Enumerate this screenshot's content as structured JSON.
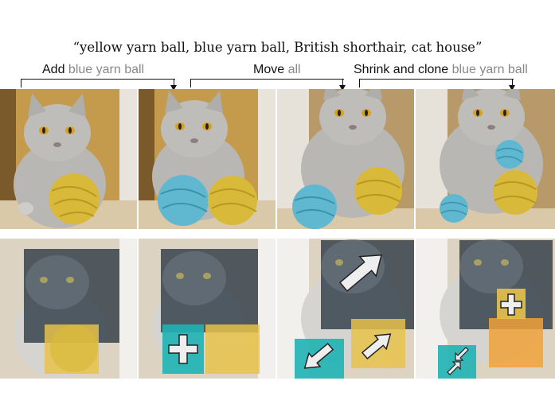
{
  "caption": "“yellow yarn ball, blue yarn ball, British shorthair, cat house”",
  "operations": [
    {
      "verb": "Add",
      "object": "blue yarn ball"
    },
    {
      "verb": "Move",
      "object": "all"
    },
    {
      "verb": "Shrink and clone",
      "object": "blue yarn ball"
    }
  ],
  "colors": {
    "yarn_yellow": "#d9b93a",
    "yarn_blue": "#5fb8d0",
    "cat_gray": "#b9b7b4",
    "mask_dark": "#2d3a45",
    "mask_yellow": "#e6c24a",
    "mask_teal": "#1fb3b5",
    "mask_orange": "#f0a23a"
  },
  "icons": [
    "plus-icon",
    "arrow-up-right-icon",
    "arrow-down-left-icon",
    "shrink-icon"
  ]
}
